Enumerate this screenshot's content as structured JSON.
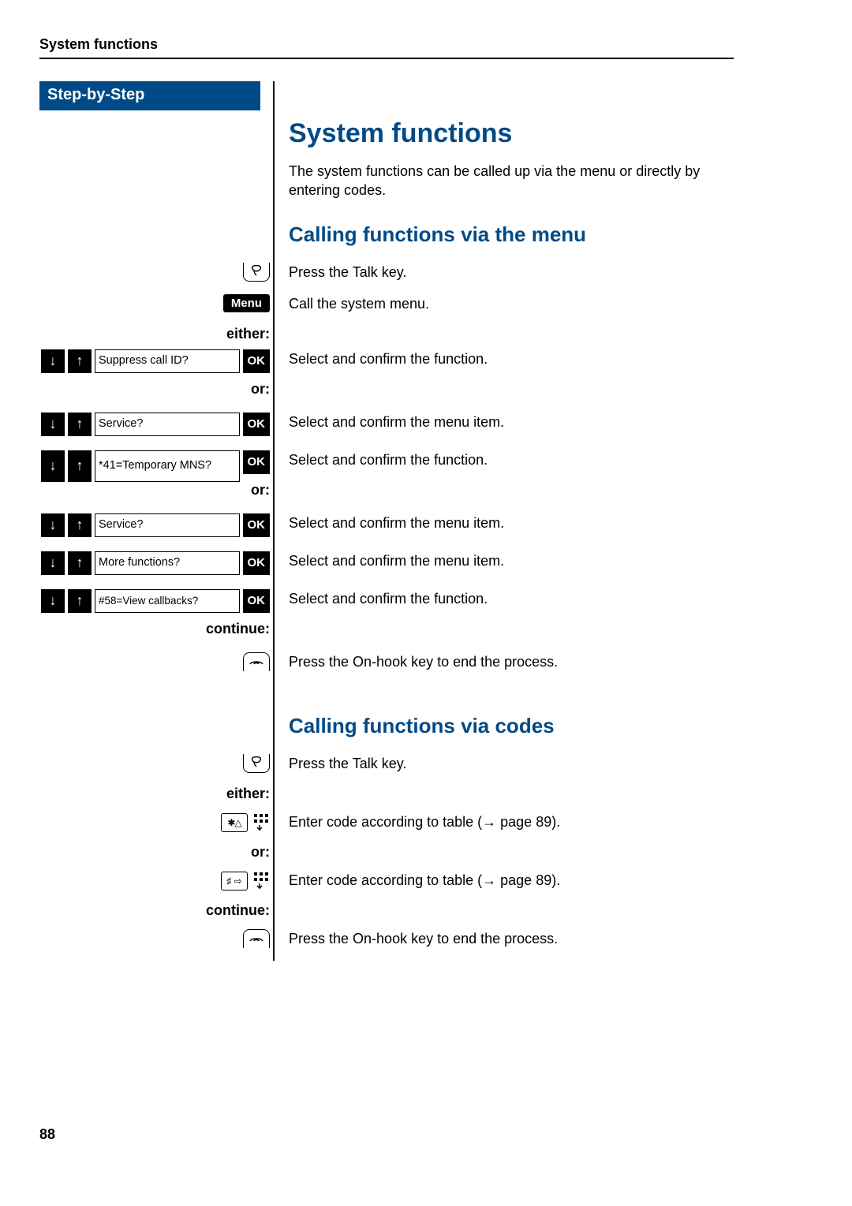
{
  "header": "System functions",
  "stepHeader": "Step-by-Step",
  "title": "System functions",
  "intro": "The system functions can be called up via the menu or directly by entering codes.",
  "section1": {
    "title": "Calling functions via the menu",
    "talk": "Press the Talk key.",
    "menuLabel": "Menu",
    "menuDesc": "Call the system menu.",
    "either": "either:",
    "or": "or:",
    "continue": "continue:",
    "ok": "OK",
    "rows": [
      {
        "display": "Suppress call ID?",
        "desc": "Select and confirm the function."
      },
      {
        "display": "Service?",
        "desc": "Select and confirm the menu item."
      },
      {
        "display": "*41=Temporary MNS?",
        "desc": "Select and confirm the function."
      },
      {
        "display": "Service?",
        "desc": "Select and confirm the menu item."
      },
      {
        "display": "More functions?",
        "desc": "Select and confirm the menu item."
      },
      {
        "display": "#58=View callbacks?",
        "desc": "Select and confirm the function."
      }
    ],
    "onhook": "Press the On-hook key to end the process."
  },
  "section2": {
    "title": "Calling functions via codes",
    "talk": "Press the Talk key.",
    "either": "either:",
    "or": "or:",
    "continue": "continue:",
    "starKey": "✱△",
    "hashKey": "♯ ⇨",
    "enterCode": "Enter code according to table (→ page 89).",
    "onhook": "Press the On-hook key to end the process."
  },
  "pageNumber": "88"
}
